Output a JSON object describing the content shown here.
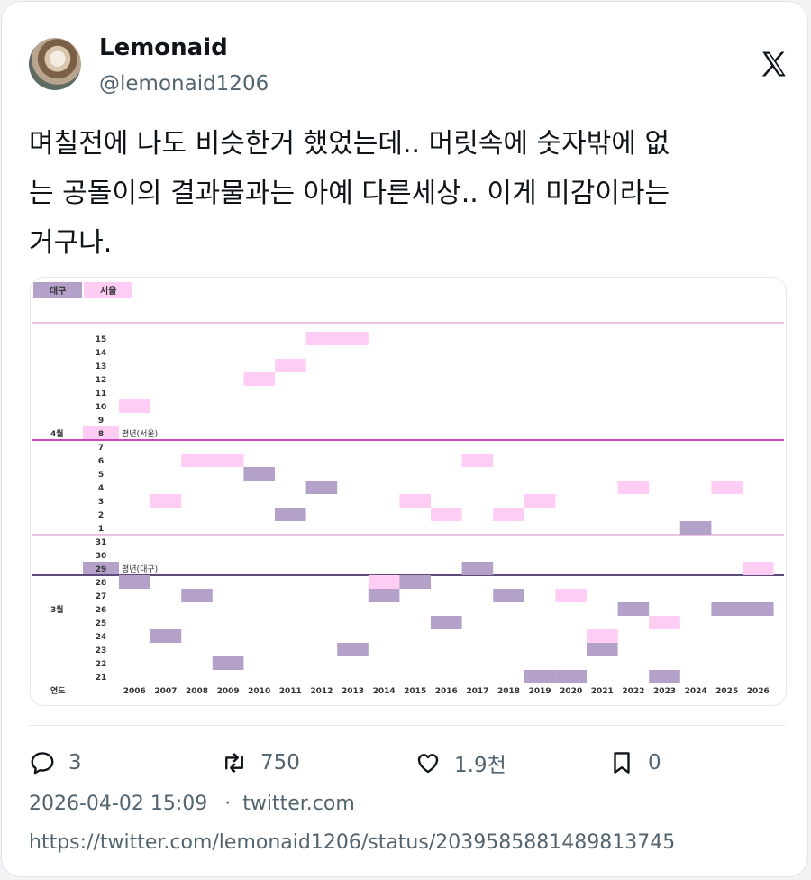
{
  "tweet": {
    "author_name": "Lemonaid",
    "author_handle": "@lemonaid1206",
    "text_lines": [
      "며칠전에 나도 비슷한거 했었는데.. 머릿속에 숫자밖에 없",
      "는 공돌이의 결과물과는 아예 다른세상.. 이게 미감이라는",
      "거구나."
    ],
    "replies": "3",
    "retweets": "750",
    "likes": "1.9천",
    "bookmarks": "0",
    "timestamp": "2026-04-02 15:09",
    "source_sep": "·",
    "source": "twitter.com",
    "url": "https://twitter.com/lemonaid1206/status/2039585881489813745"
  },
  "icons": {
    "platform": "x-logo-icon",
    "reply": "reply-icon",
    "retweet": "retweet-icon",
    "like": "heart-icon",
    "bookmark": "bookmark-icon"
  },
  "chart_data": {
    "type": "heatmap",
    "title": "",
    "xlabel": "연도",
    "legend": [
      {
        "name": "대구",
        "color": "#b3a1c9"
      },
      {
        "name": "서울",
        "color": "#ffcdf4"
      }
    ],
    "years": [
      "2006",
      "2007",
      "2008",
      "2009",
      "2010",
      "2011",
      "2012",
      "2013",
      "2014",
      "2015",
      "2016",
      "2017",
      "2018",
      "2019",
      "2020",
      "2021",
      "2022",
      "2023",
      "2024",
      "2025",
      "2026"
    ],
    "month_labels": [
      {
        "label": "4월",
        "at": "4-8"
      },
      {
        "label": "3월",
        "at": "3-26"
      }
    ],
    "date_ticks": [
      {
        "label": "15",
        "key": "4-15"
      },
      {
        "label": "14",
        "key": "4-14"
      },
      {
        "label": "13",
        "key": "4-13"
      },
      {
        "label": "12",
        "key": "4-12"
      },
      {
        "label": "11",
        "key": "4-11"
      },
      {
        "label": "10",
        "key": "4-10"
      },
      {
        "label": "9",
        "key": "4-9"
      },
      {
        "label": "8",
        "key": "4-8"
      },
      {
        "label": "7",
        "key": "4-7"
      },
      {
        "label": "6",
        "key": "4-6"
      },
      {
        "label": "5",
        "key": "4-5"
      },
      {
        "label": "4",
        "key": "4-4"
      },
      {
        "label": "3",
        "key": "4-3"
      },
      {
        "label": "2",
        "key": "4-2"
      },
      {
        "label": "1",
        "key": "4-1"
      },
      {
        "label": "31",
        "key": "3-31"
      },
      {
        "label": "30",
        "key": "3-30"
      },
      {
        "label": "29",
        "key": "3-29"
      },
      {
        "label": "28",
        "key": "3-28"
      },
      {
        "label": "27",
        "key": "3-27"
      },
      {
        "label": "26",
        "key": "3-26"
      },
      {
        "label": "25",
        "key": "3-25"
      },
      {
        "label": "24",
        "key": "3-24"
      },
      {
        "label": "23",
        "key": "3-23"
      },
      {
        "label": "22",
        "key": "3-22"
      },
      {
        "label": "21",
        "key": "3-21"
      }
    ],
    "reference_lines": [
      {
        "label": "평년(서울)",
        "at": "4-8",
        "series": "서울"
      },
      {
        "label": "평년(대구)",
        "at": "3-29",
        "series": "대구"
      }
    ],
    "series": [
      {
        "name": "서울",
        "points": [
          {
            "year": "2006",
            "date": "4-10"
          },
          {
            "year": "2007",
            "date": "4-3"
          },
          {
            "year": "2008",
            "date": "4-6"
          },
          {
            "year": "2009",
            "date": "4-6"
          },
          {
            "year": "2010",
            "date": "4-12"
          },
          {
            "year": "2011",
            "date": "4-13"
          },
          {
            "year": "2012",
            "date": "4-15"
          },
          {
            "year": "2013",
            "date": "4-15"
          },
          {
            "year": "2014",
            "date": "3-28"
          },
          {
            "year": "2015",
            "date": "4-3"
          },
          {
            "year": "2016",
            "date": "4-2"
          },
          {
            "year": "2017",
            "date": "4-6"
          },
          {
            "year": "2018",
            "date": "4-2"
          },
          {
            "year": "2019",
            "date": "4-3"
          },
          {
            "year": "2020",
            "date": "3-27"
          },
          {
            "year": "2021",
            "date": "3-24"
          },
          {
            "year": "2022",
            "date": "4-4"
          },
          {
            "year": "2023",
            "date": "3-25"
          },
          {
            "year": "2024",
            "date": "4-1"
          },
          {
            "year": "2025",
            "date": "4-4"
          },
          {
            "year": "2026",
            "date": "3-29"
          }
        ]
      },
      {
        "name": "대구",
        "points": [
          {
            "year": "2006",
            "date": "3-28"
          },
          {
            "year": "2007",
            "date": "3-24"
          },
          {
            "year": "2008",
            "date": "3-27"
          },
          {
            "year": "2009",
            "date": "3-22"
          },
          {
            "year": "2010",
            "date": "4-5"
          },
          {
            "year": "2011",
            "date": "4-2"
          },
          {
            "year": "2012",
            "date": "4-4"
          },
          {
            "year": "2013",
            "date": "3-23"
          },
          {
            "year": "2014",
            "date": "3-27"
          },
          {
            "year": "2015",
            "date": "3-28"
          },
          {
            "year": "2016",
            "date": "3-25"
          },
          {
            "year": "2017",
            "date": "3-29"
          },
          {
            "year": "2018",
            "date": "3-27"
          },
          {
            "year": "2019",
            "date": "3-21"
          },
          {
            "year": "2020",
            "date": "3-21"
          },
          {
            "year": "2021",
            "date": "3-23"
          },
          {
            "year": "2022",
            "date": "3-26"
          },
          {
            "year": "2023",
            "date": "3-21"
          },
          {
            "year": "2024",
            "date": "4-1"
          },
          {
            "year": "2025",
            "date": "3-26"
          },
          {
            "year": "2026",
            "date": "3-26"
          }
        ]
      }
    ],
    "grid": false
  }
}
